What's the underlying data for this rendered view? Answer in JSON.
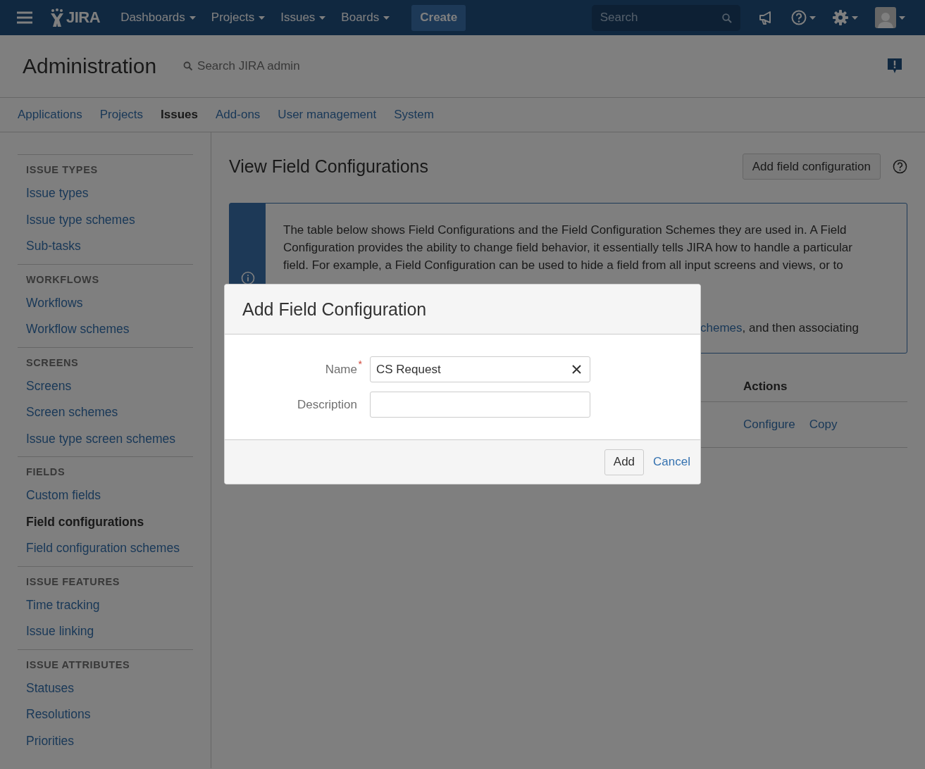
{
  "header": {
    "logo_text": "JIRA",
    "nav": [
      {
        "label": "Dashboards"
      },
      {
        "label": "Projects"
      },
      {
        "label": "Issues"
      },
      {
        "label": "Boards"
      }
    ],
    "create": "Create",
    "search": {
      "placeholder": "Search"
    }
  },
  "admin": {
    "title": "Administration",
    "search_placeholder": "Search JIRA admin"
  },
  "tabs": [
    {
      "label": "Applications",
      "selected": false
    },
    {
      "label": "Projects",
      "selected": false
    },
    {
      "label": "Issues",
      "selected": true
    },
    {
      "label": "Add-ons",
      "selected": false
    },
    {
      "label": "User management",
      "selected": false
    },
    {
      "label": "System",
      "selected": false
    }
  ],
  "sidebar": {
    "sections": [
      {
        "heading": "ISSUE TYPES",
        "items": [
          {
            "label": "Issue types",
            "selected": false
          },
          {
            "label": "Issue type schemes",
            "selected": false
          },
          {
            "label": "Sub-tasks",
            "selected": false
          }
        ]
      },
      {
        "heading": "WORKFLOWS",
        "items": [
          {
            "label": "Workflows",
            "selected": false
          },
          {
            "label": "Workflow schemes",
            "selected": false
          }
        ]
      },
      {
        "heading": "SCREENS",
        "items": [
          {
            "label": "Screens",
            "selected": false
          },
          {
            "label": "Screen schemes",
            "selected": false
          },
          {
            "label": "Issue type screen schemes",
            "selected": false
          }
        ]
      },
      {
        "heading": "FIELDS",
        "items": [
          {
            "label": "Custom fields",
            "selected": false
          },
          {
            "label": "Field configurations",
            "selected": true
          },
          {
            "label": "Field configuration schemes",
            "selected": false
          }
        ]
      },
      {
        "heading": "ISSUE FEATURES",
        "items": [
          {
            "label": "Time tracking",
            "selected": false
          },
          {
            "label": "Issue linking",
            "selected": false
          }
        ]
      },
      {
        "heading": "ISSUE ATTRIBUTES",
        "items": [
          {
            "label": "Statuses",
            "selected": false
          },
          {
            "label": "Resolutions",
            "selected": false
          },
          {
            "label": "Priorities",
            "selected": false
          }
        ]
      }
    ]
  },
  "page": {
    "title": "View Field Configurations",
    "add_button": "Add field configuration",
    "info": {
      "paragraph_1": "The table below shows Field Configurations and the Field Configuration Schemes they are used in. A Field Configuration provides the ability to change field behavior, it essentially tells JIRA how to handle a particular field. For example, a Field Configuration can be used to hide a field from all input screens and views, or to",
      "paragraph_2_link": "chemes",
      "paragraph_2_rest": ", and then associating"
    },
    "table": {
      "columns": [
        "Actions"
      ],
      "rows": [
        {
          "actions": [
            "Configure",
            "Copy"
          ]
        }
      ]
    }
  },
  "dialog": {
    "title": "Add Field Configuration",
    "required_mark": "*",
    "fields": [
      {
        "label": "Name",
        "required": true,
        "value": "CS Request"
      },
      {
        "label": "Description",
        "required": false
      }
    ],
    "submit": "Add",
    "cancel": "Cancel"
  }
}
